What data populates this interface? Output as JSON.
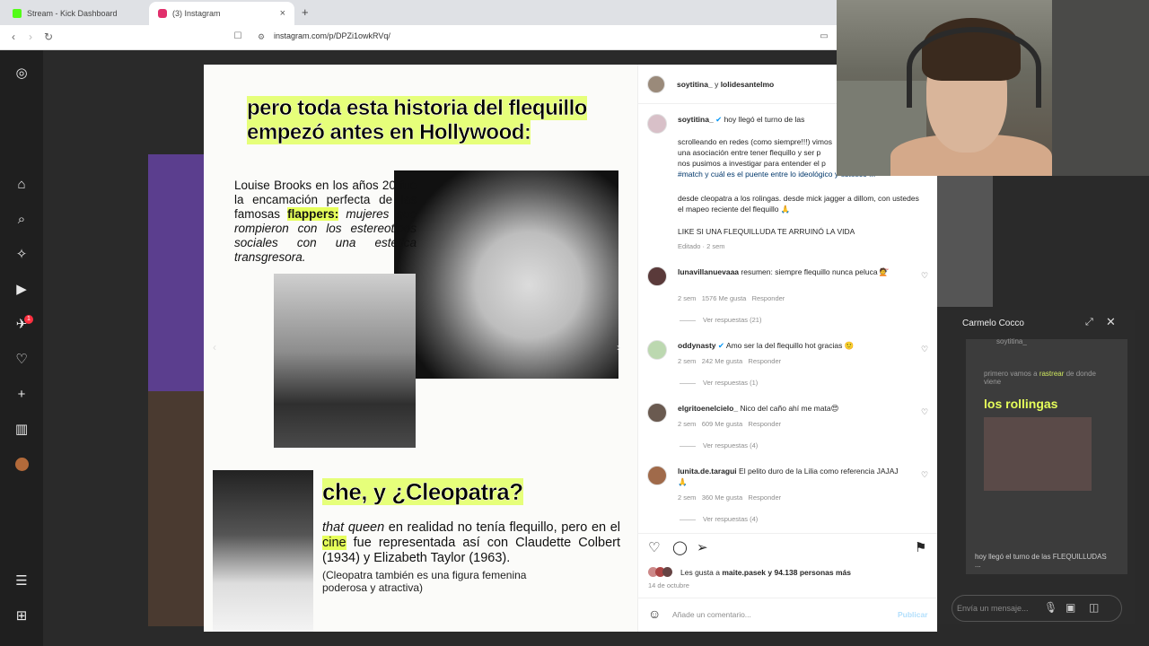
{
  "browser": {
    "tabs": [
      {
        "label": "Stream - Kick Dashboard",
        "favicon_color": "#53fc18"
      },
      {
        "label": "(3) Instagram",
        "favicon_color": "#e1306c"
      }
    ],
    "new_tab_symbol": "+",
    "close_symbol": "×",
    "url": "instagram.com/p/DPZi1owkRVq/"
  },
  "post": {
    "headline": [
      "pero toda esta historia del flequillo",
      "empezó antes en Hollywood:"
    ],
    "brooks_before": "Louise Brooks en los años 20 fue la encamación perfecta de las famosas ",
    "brooks_highlight": "flappers:",
    "brooks_after": " mujeres que rompieron con los estereotipos sociales con una estética transgresora.",
    "cleo_headline": "che, y ¿Cleopatra?",
    "cleo_italic": "that queen",
    "cleo_text_1": " en realidad no tenía flequillo, pero en el ",
    "cleo_highlight": "cine",
    "cleo_text_2": " fue representada así con Claudette Colbert (1934) y Elizabeth Taylor (1963).",
    "cleo_note": "(Cleopatra también es una figura femenina poderosa y atractiva)"
  },
  "panel": {
    "header_user": "soytitina_",
    "header_joiner": "y",
    "header_collab": "lolidesantelmo",
    "caption_user": "soytitina_",
    "caption_first": "hoy llegó el turno de las",
    "caption_lines": [
      "scrolleando en redes (como siempre!!!) vimos",
      "una asociación entre tener flequillo y ser p",
      "nos pusimos a investigar para entender el p",
      "#match y cuál es el puente entre lo ideológico y estético !!!"
    ],
    "caption_line2": "desde cleopatra a los rolingas. desde mick jagger a dillom, con ustedes el mapeo reciente del flequillo 🙏",
    "caption_line3": "LIKE SI UNA FLEQUILLUDA TE ARRUINÓ LA VIDA",
    "caption_meta": "Editado · 2 sem",
    "comments": [
      {
        "user": "lunavillanuevaaa",
        "text": "resumen: siempre flequillo nunca peluca 💇",
        "age": "2 sem",
        "likes": "1576 Me gusta",
        "reply": "Responder",
        "replies": "Ver respuestas (21)"
      },
      {
        "user": "oddynasty",
        "text": "Amo ser la del flequillo hot gracias 🙂",
        "age": "2 sem",
        "likes": "242 Me gusta",
        "reply": "Responder",
        "replies": "Ver respuestas (1)"
      },
      {
        "user": "elgritoenelcielo_",
        "text": "Nico del caño ahí me mata😍",
        "age": "2 sem",
        "likes": "609 Me gusta",
        "reply": "Responder",
        "replies": "Ver respuestas (4)"
      },
      {
        "user": "lunita.de.taragui",
        "text": "El pelito duro de la Lilia como referencia JAJAJ 🙏",
        "age": "2 sem",
        "likes": "360 Me gusta",
        "reply": "Responder",
        "replies": "Ver respuestas (4)"
      }
    ],
    "likes_prefix": "Les gusta a",
    "likes_user": "maite.pasek",
    "likes_suffix": "y 94.138 personas más",
    "date": "14 de octubre",
    "comment_placeholder": "Añade un comentario...",
    "publish": "Publicar"
  },
  "chat": {
    "name": "Carmelo Cocco",
    "sample_user": "soytitina_",
    "sample_text_1": "primero vamos a",
    "sample_text_2": "de donde viene",
    "sample_title": "los rollingas",
    "sample_caption": "hoy llegó el turno de las FLEQUILLUDAS ...",
    "placeholder": "Envía un mensaje..."
  },
  "left_nav": {
    "badge": "1"
  },
  "colors": {
    "highlight": "#e6ff5a",
    "link": "#00376b",
    "accent": "#0095f6"
  }
}
